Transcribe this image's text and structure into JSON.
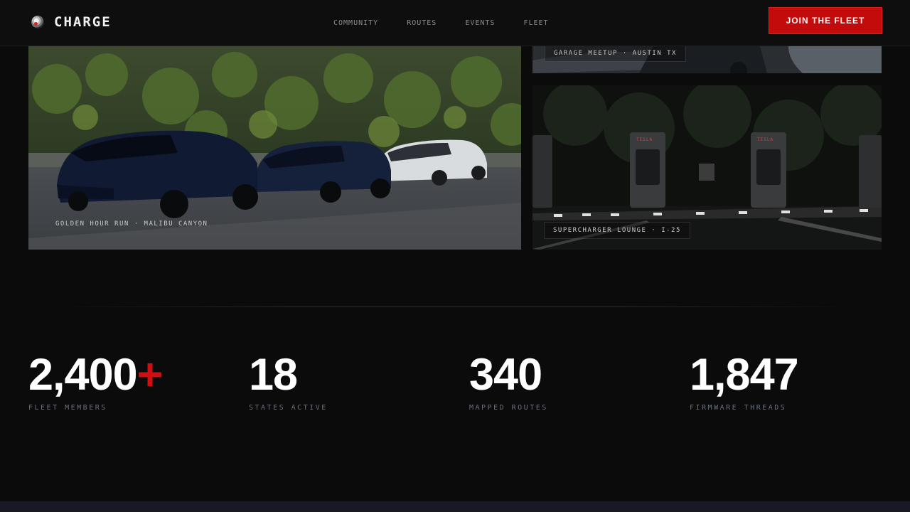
{
  "header": {
    "brand": "CHARGE",
    "nav": [
      "COMMUNITY",
      "ROUTES",
      "EVENTS",
      "FLEET"
    ],
    "cta": "JOIN THE FLEET"
  },
  "gallery": {
    "main_caption": "GOLDEN HOUR RUN · MALIBU CANYON",
    "top_right_caption": "GARAGE MEETUP · AUSTIN TX",
    "bottom_right_caption": "SUPERCHARGER LOUNGE · I-25",
    "charger_sign": "TESLA"
  },
  "stats": [
    {
      "value": "2,400",
      "suffix": "+",
      "label": "FLEET MEMBERS"
    },
    {
      "value": "18",
      "suffix": "",
      "label": "STATES ACTIVE"
    },
    {
      "value": "340",
      "suffix": "",
      "label": "MAPPED ROUTES"
    },
    {
      "value": "1,847",
      "suffix": "",
      "label": "FIRMWARE THREADS"
    }
  ],
  "colors": {
    "accent": "#c40b0b",
    "background": "#0b0b0b",
    "label": "#6a6f82"
  },
  "icons": {
    "brand": "charge-logo-icon"
  }
}
